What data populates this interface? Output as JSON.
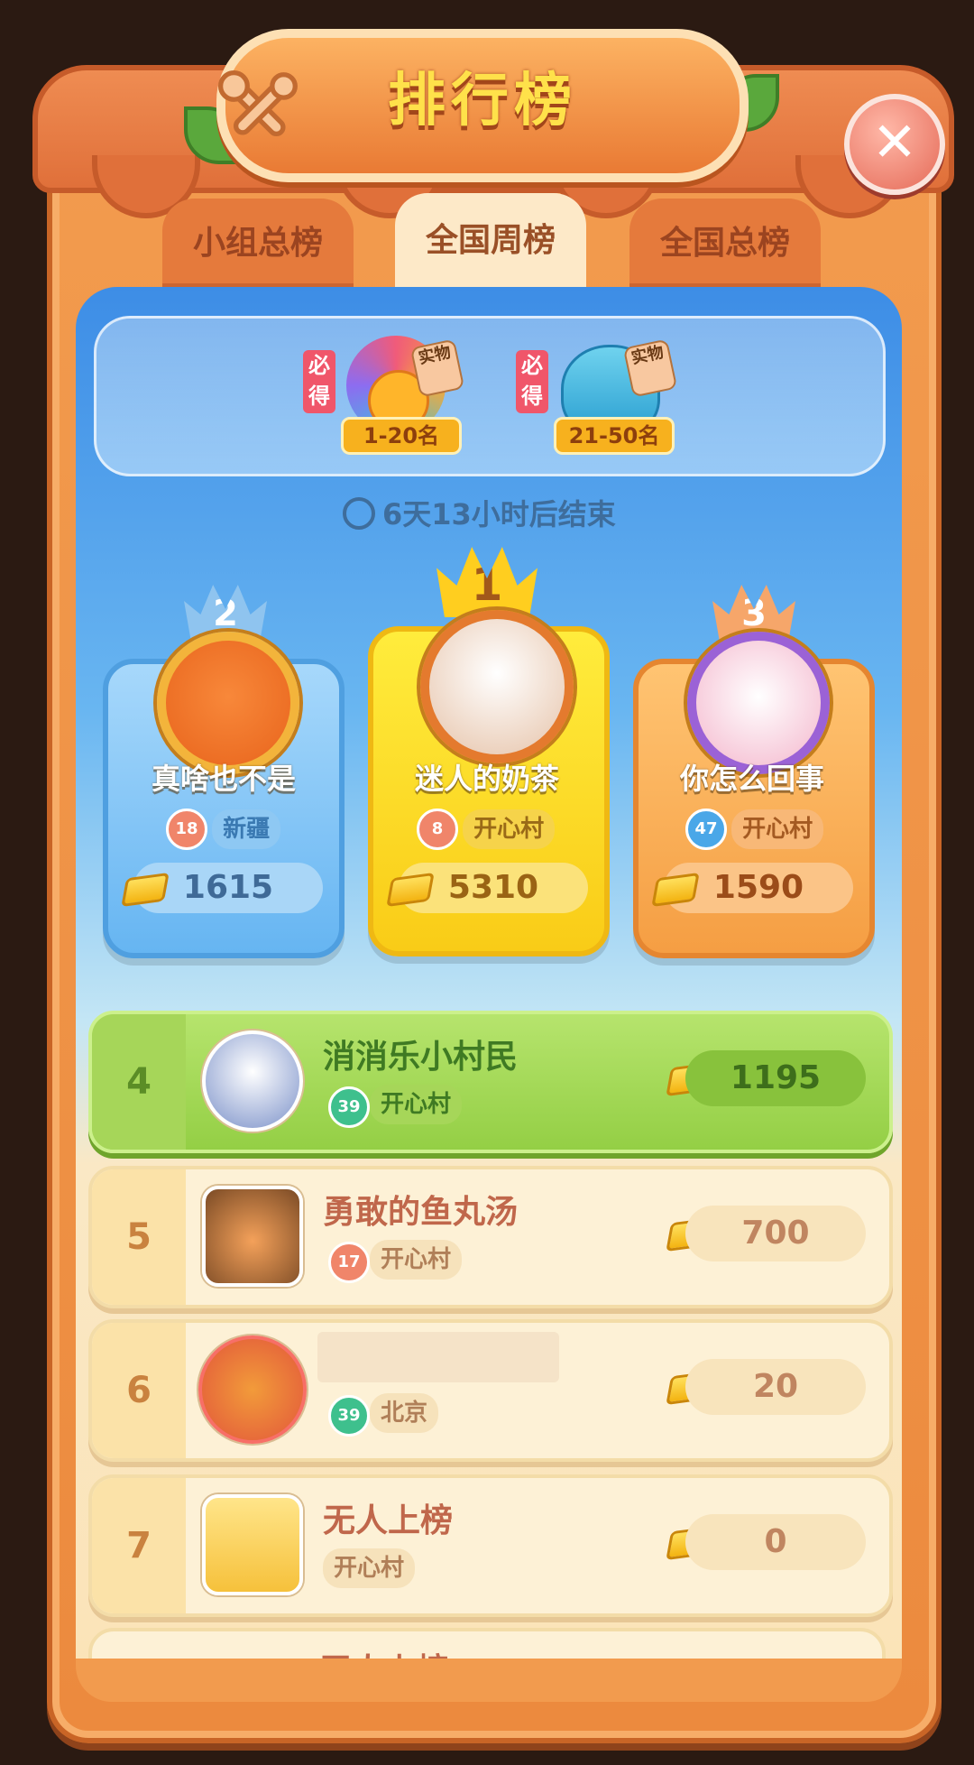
{
  "header": {
    "title": "排行榜",
    "close_icon": "close-icon"
  },
  "tabs": [
    {
      "label": "小组总榜",
      "active": false
    },
    {
      "label": "全国周榜",
      "active": true
    },
    {
      "label": "全国总榜",
      "active": false
    }
  ],
  "rewards": [
    {
      "must": "必得",
      "real": "实物",
      "range": "1-20名"
    },
    {
      "must": "必得",
      "real": "实物",
      "range": "21-50名"
    }
  ],
  "timer": {
    "icon": "clock-icon",
    "text": "6天13小时后结束"
  },
  "podium": [
    {
      "rank": "2",
      "name": "真啥也不是",
      "level": "18",
      "region": "新疆",
      "score": "1615"
    },
    {
      "rank": "1",
      "name": "迷人的奶茶",
      "level": "8",
      "region": "开心村",
      "score": "5310"
    },
    {
      "rank": "3",
      "name": "你怎么回事",
      "level": "47",
      "region": "开心村",
      "score": "1590"
    }
  ],
  "list": [
    {
      "rank": "4",
      "name": "消消乐小村民",
      "level": "39",
      "region": "开心村",
      "score": "1195",
      "highlight": true
    },
    {
      "rank": "5",
      "name": "勇敢的鱼丸汤",
      "level": "17",
      "region": "开心村",
      "score": "700"
    },
    {
      "rank": "6",
      "name": "",
      "level": "39",
      "region": "北京",
      "score": "20"
    },
    {
      "rank": "7",
      "name": "无人上榜",
      "region": "开心村",
      "score": "0"
    },
    {
      "name": "无人上榜"
    }
  ],
  "colors": {
    "frame": "#ec8a3e",
    "gold_card": "#f9cc17",
    "blue_card": "#66b5f2",
    "orange_card": "#f59e43",
    "highlight_row": "#94cf45"
  }
}
